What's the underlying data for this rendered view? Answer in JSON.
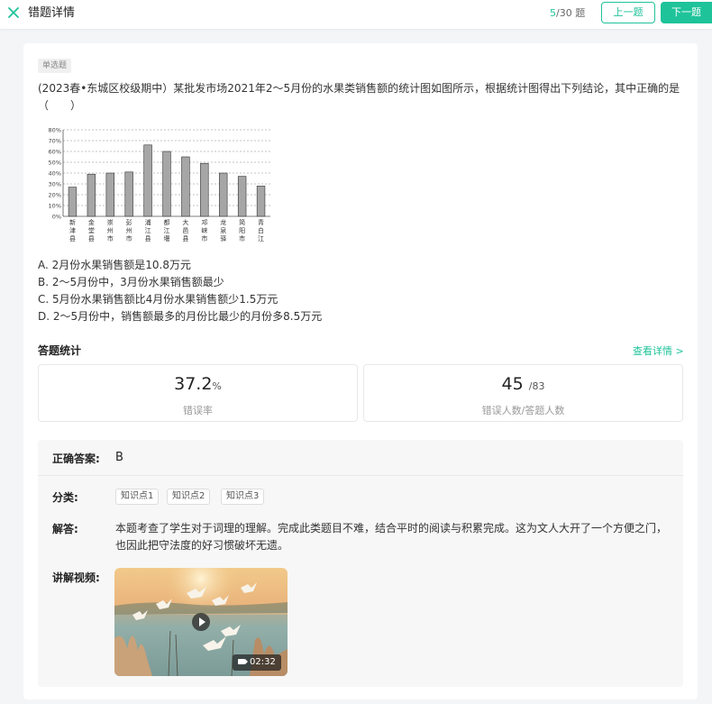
{
  "header": {
    "title": "错题详情",
    "progress_current": "5",
    "progress_total": "/30 题",
    "prev_label": "上一题",
    "next_label": "下一题"
  },
  "question": {
    "type": "单选题",
    "stem": "(2023春•东城区校级期中）某批发市场2021年2～5月份的水果类销售额的统计图如图所示，根据统计图得出下列结论，其中正确的是（　　）",
    "options": [
      "A.  2月份水果销售额是10.8万元",
      "B.  2～5月份中，3月份水果销售额最少",
      "C.  5月份水果销售额比4月份水果销售额少1.5万元",
      "D.  2～5月份中，销售额最多的月份比最少的月份多8.5万元"
    ]
  },
  "chart_data": {
    "type": "bar",
    "categories": [
      "新津县",
      "金堂县",
      "崇州市",
      "彭州市",
      "浦江县",
      "都江堰",
      "大邑县",
      "邛崃市",
      "龙泉驿",
      "简阳市",
      "青白江"
    ],
    "values": [
      27,
      39,
      40,
      41,
      66,
      60,
      55,
      49,
      40,
      37,
      28
    ],
    "yticks": [
      "80%",
      "70%",
      "60%",
      "50%",
      "40%",
      "30%",
      "20%",
      "10%",
      "0%"
    ],
    "ylim": [
      0,
      80
    ],
    "grid": "dashed horizontal",
    "bar_color": "#a6a6a6"
  },
  "stats": {
    "title": "答题统计",
    "detail_link": "查看详情 >",
    "error_rate": "37.2",
    "error_rate_unit": "%",
    "error_rate_label": "错误率",
    "wrong_count": "45",
    "total_count": "/83",
    "count_label": "错误人数/答题人数"
  },
  "answer": {
    "correct_label": "正确答案:",
    "correct_value": "B",
    "category_label": "分类:",
    "tags": [
      "知识点1",
      "知识点2",
      "知识点3"
    ],
    "analysis_label": "解答:",
    "analysis_text": "本题考查了学生对于词理的理解。完成此类题目不难，结合平时的阅读与积累完成。这为文人大开了一个方便之门，也因此把守法度的好习惯破坏无遗。",
    "video_label": "讲解视频:",
    "video_duration": "02:32"
  },
  "colors": {
    "accent": "#1ec39a"
  }
}
